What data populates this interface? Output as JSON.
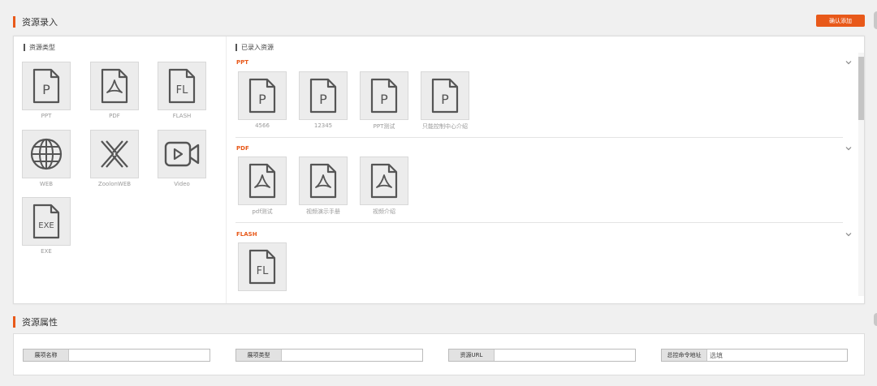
{
  "section_entry": {
    "title": "资源录入"
  },
  "confirm_button": {
    "label": "确认添加"
  },
  "resource_types": {
    "title": "资源类型",
    "items": [
      {
        "glyph": "P",
        "icon": "ppt-file-icon",
        "label": "PPT"
      },
      {
        "glyph": "",
        "icon": "pdf-file-icon",
        "label": "PDF"
      },
      {
        "glyph": "FL",
        "icon": "flash-file-icon",
        "label": "FLASH"
      },
      {
        "glyph": "",
        "icon": "globe-icon",
        "label": "WEB"
      },
      {
        "glyph": "",
        "icon": "zoolon-web-icon",
        "label": "ZoolonWEB"
      },
      {
        "glyph": "",
        "icon": "video-camera-icon",
        "label": "Video"
      },
      {
        "glyph": "EXE",
        "icon": "exe-file-icon",
        "label": "EXE"
      }
    ]
  },
  "entered_resources": {
    "title": "已录入资源",
    "groups": [
      {
        "name": "PPT",
        "items": [
          {
            "glyph": "P",
            "label": "4566"
          },
          {
            "glyph": "P",
            "label": "12345"
          },
          {
            "glyph": "P",
            "label": "PPT测试"
          },
          {
            "glyph": "P",
            "label": "只能控制中心介绍"
          }
        ]
      },
      {
        "name": "PDF",
        "items": [
          {
            "glyph": "",
            "label": "pdf测试"
          },
          {
            "glyph": "",
            "label": "视频演示手册"
          },
          {
            "glyph": "",
            "label": "视频介绍"
          }
        ]
      },
      {
        "name": "FLASH",
        "items": [
          {
            "glyph": "FL",
            "label": ""
          }
        ]
      }
    ]
  },
  "section_attributes": {
    "title": "资源属性"
  },
  "attribute_fields": [
    {
      "label": "展项名称",
      "value": "",
      "placeholder": ""
    },
    {
      "label": "展项类型",
      "value": "",
      "placeholder": ""
    },
    {
      "label": "资源URL",
      "value": "",
      "placeholder": ""
    },
    {
      "label": "总控命令地址",
      "value": "",
      "placeholder": "选填"
    }
  ],
  "colors": {
    "accent": "#e8591a",
    "icon_stroke": "#555555",
    "tile_bg": "#ececec"
  }
}
